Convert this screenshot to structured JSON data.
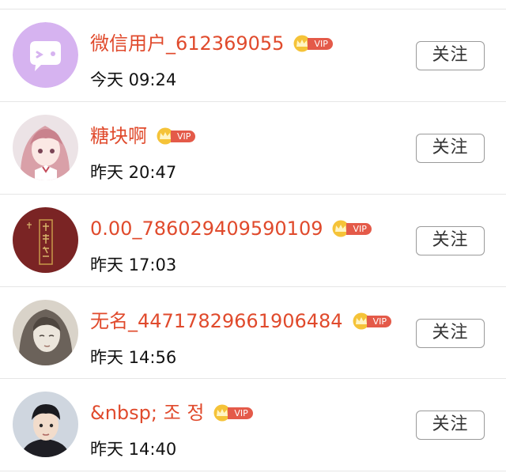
{
  "follow_label": "关注",
  "vip_label": "VIP",
  "colors": {
    "name": "#e04a2c",
    "vip_badge": "#e45a49",
    "separator": "#e6e6e6"
  },
  "users": [
    {
      "name": "微信用户_612369055",
      "time": "今天 09:24",
      "avatar_icon": "wechat-default-avatar"
    },
    {
      "name": "糖块啊",
      "time": "昨天 20:47",
      "avatar_icon": "anime-girl-avatar"
    },
    {
      "name": "0.00_786029409590109",
      "time": "昨天 17:03",
      "avatar_icon": "red-calligraphy-avatar"
    },
    {
      "name": "无名_44717829661906484",
      "time": "昨天 14:56",
      "avatar_icon": "sketch-portrait-avatar"
    },
    {
      "name": "&nbsp; 조 정",
      "time": "昨天 14:40",
      "avatar_icon": "photo-portrait-avatar"
    }
  ]
}
